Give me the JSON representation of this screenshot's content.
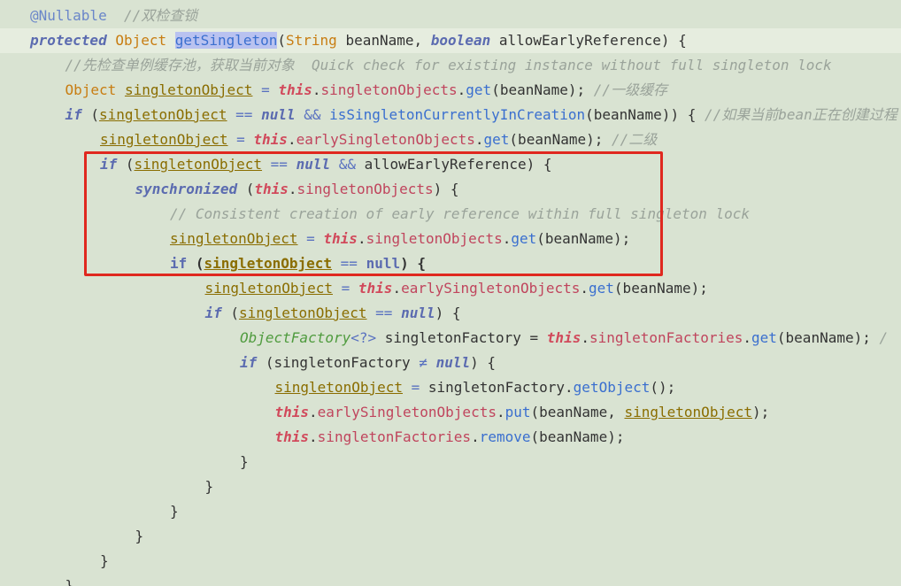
{
  "editor": {
    "lines": [
      {
        "indent": 0,
        "segments": [
          {
            "t": "@Nullable",
            "c": "ann"
          },
          {
            "t": "  ",
            "c": "text"
          },
          {
            "t": "//双检查锁",
            "c": "comment"
          }
        ]
      },
      {
        "indent": 0,
        "current": true,
        "segments": [
          {
            "t": "protected",
            "c": "kw"
          },
          {
            "t": " ",
            "c": "text"
          },
          {
            "t": "Object",
            "c": "type"
          },
          {
            "t": " ",
            "c": "text"
          },
          {
            "t": "getSingleton",
            "c": "sel"
          },
          {
            "t": "(",
            "c": "text"
          },
          {
            "t": "String",
            "c": "type"
          },
          {
            "t": " beanName, ",
            "c": "text"
          },
          {
            "t": "boolean",
            "c": "kw"
          },
          {
            "t": " allowEarlyReference) {",
            "c": "text"
          }
        ]
      },
      {
        "indent": 1,
        "segments": [
          {
            "t": "//先检查单例缓存池，获取当前对象  Quick check for existing instance without full singleton lock",
            "c": "comment"
          }
        ]
      },
      {
        "indent": 1,
        "segments": [
          {
            "t": "Object",
            "c": "type"
          },
          {
            "t": " ",
            "c": "text"
          },
          {
            "t": "singletonObject",
            "c": "var"
          },
          {
            "t": " = ",
            "c": "op"
          },
          {
            "t": "this",
            "c": "this"
          },
          {
            "t": ".",
            "c": "text"
          },
          {
            "t": "singletonObjects",
            "c": "field"
          },
          {
            "t": ".",
            "c": "text"
          },
          {
            "t": "get",
            "c": "method"
          },
          {
            "t": "(beanName); ",
            "c": "text"
          },
          {
            "t": "//一级缓存",
            "c": "comment"
          }
        ]
      },
      {
        "indent": 1,
        "segments": [
          {
            "t": "if",
            "c": "kw"
          },
          {
            "t": " (",
            "c": "text"
          },
          {
            "t": "singletonObject",
            "c": "var"
          },
          {
            "t": " == ",
            "c": "op"
          },
          {
            "t": "null",
            "c": "kw"
          },
          {
            "t": " && ",
            "c": "op"
          },
          {
            "t": "isSingletonCurrentlyInCreation",
            "c": "method"
          },
          {
            "t": "(beanName)) { ",
            "c": "text"
          },
          {
            "t": "//如果当前bean正在创建过程",
            "c": "comment"
          }
        ]
      },
      {
        "indent": 2,
        "segments": [
          {
            "t": "singletonObject",
            "c": "var"
          },
          {
            "t": " = ",
            "c": "op"
          },
          {
            "t": "this",
            "c": "this"
          },
          {
            "t": ".",
            "c": "text"
          },
          {
            "t": "earlySingletonObjects",
            "c": "field"
          },
          {
            "t": ".",
            "c": "text"
          },
          {
            "t": "get",
            "c": "method"
          },
          {
            "t": "(beanName); ",
            "c": "text"
          },
          {
            "t": "//二级",
            "c": "comment"
          }
        ]
      },
      {
        "indent": 2,
        "segments": [
          {
            "t": "if",
            "c": "kw"
          },
          {
            "t": " (",
            "c": "text"
          },
          {
            "t": "singletonObject",
            "c": "var"
          },
          {
            "t": " == ",
            "c": "op"
          },
          {
            "t": "null",
            "c": "kw"
          },
          {
            "t": " && ",
            "c": "op"
          },
          {
            "t": "allowEarlyReference) {",
            "c": "text"
          }
        ]
      },
      {
        "indent": 3,
        "segments": [
          {
            "t": "synchronized",
            "c": "kw"
          },
          {
            "t": " (",
            "c": "text"
          },
          {
            "t": "this",
            "c": "this"
          },
          {
            "t": ".",
            "c": "text"
          },
          {
            "t": "singletonObjects",
            "c": "field"
          },
          {
            "t": ") {",
            "c": "text"
          }
        ]
      },
      {
        "indent": 4,
        "segments": [
          {
            "t": "// Consistent creation of early reference within full singleton lock",
            "c": "comment"
          }
        ]
      },
      {
        "indent": 4,
        "segments": [
          {
            "t": "singletonObject",
            "c": "var"
          },
          {
            "t": " = ",
            "c": "op"
          },
          {
            "t": "this",
            "c": "this"
          },
          {
            "t": ".",
            "c": "text"
          },
          {
            "t": "singletonObjects",
            "c": "field"
          },
          {
            "t": ".",
            "c": "text"
          },
          {
            "t": "get",
            "c": "method"
          },
          {
            "t": "(beanName);",
            "c": "text"
          }
        ]
      },
      {
        "indent": 4,
        "segments": [
          {
            "t": "if",
            "c": "kwb"
          },
          {
            "t": " (",
            "c": "textb"
          },
          {
            "t": "singletonObject",
            "c": "varb"
          },
          {
            "t": " == ",
            "c": "op"
          },
          {
            "t": "null",
            "c": "kwb"
          },
          {
            "t": ") {",
            "c": "textb"
          }
        ]
      },
      {
        "indent": 5,
        "segments": [
          {
            "t": "singletonObject",
            "c": "var"
          },
          {
            "t": " = ",
            "c": "op"
          },
          {
            "t": "this",
            "c": "this"
          },
          {
            "t": ".",
            "c": "text"
          },
          {
            "t": "earlySingletonObjects",
            "c": "field"
          },
          {
            "t": ".",
            "c": "text"
          },
          {
            "t": "get",
            "c": "method"
          },
          {
            "t": "(beanName);",
            "c": "text"
          }
        ]
      },
      {
        "indent": 5,
        "segments": [
          {
            "t": "if",
            "c": "kw"
          },
          {
            "t": " (",
            "c": "text"
          },
          {
            "t": "singletonObject",
            "c": "var"
          },
          {
            "t": " == ",
            "c": "op"
          },
          {
            "t": "null",
            "c": "kw"
          },
          {
            "t": ") {",
            "c": "text"
          }
        ]
      },
      {
        "indent": 6,
        "segments": [
          {
            "t": "ObjectFactory",
            "c": "iface"
          },
          {
            "t": "<?>",
            "c": "op"
          },
          {
            "t": " singletonFactory = ",
            "c": "text"
          },
          {
            "t": "this",
            "c": "this"
          },
          {
            "t": ".",
            "c": "text"
          },
          {
            "t": "singletonFactories",
            "c": "field"
          },
          {
            "t": ".",
            "c": "text"
          },
          {
            "t": "get",
            "c": "method"
          },
          {
            "t": "(beanName); ",
            "c": "text"
          },
          {
            "t": "/",
            "c": "comment"
          }
        ]
      },
      {
        "indent": 6,
        "segments": [
          {
            "t": "if",
            "c": "kw"
          },
          {
            "t": " (singletonFactory ",
            "c": "text"
          },
          {
            "t": "≠",
            "c": "op"
          },
          {
            "t": " ",
            "c": "text"
          },
          {
            "t": "null",
            "c": "kw"
          },
          {
            "t": ") {",
            "c": "text"
          }
        ]
      },
      {
        "indent": 7,
        "segments": [
          {
            "t": "singletonObject",
            "c": "var"
          },
          {
            "t": " = ",
            "c": "op"
          },
          {
            "t": "singletonFactory.",
            "c": "text"
          },
          {
            "t": "getObject",
            "c": "method"
          },
          {
            "t": "();",
            "c": "text"
          }
        ]
      },
      {
        "indent": 7,
        "segments": [
          {
            "t": "this",
            "c": "this"
          },
          {
            "t": ".",
            "c": "text"
          },
          {
            "t": "earlySingletonObjects",
            "c": "field"
          },
          {
            "t": ".",
            "c": "text"
          },
          {
            "t": "put",
            "c": "method"
          },
          {
            "t": "(beanName, ",
            "c": "text"
          },
          {
            "t": "singletonObject",
            "c": "var"
          },
          {
            "t": ");",
            "c": "text"
          }
        ]
      },
      {
        "indent": 7,
        "segments": [
          {
            "t": "this",
            "c": "this"
          },
          {
            "t": ".",
            "c": "text"
          },
          {
            "t": "singletonFactories",
            "c": "field"
          },
          {
            "t": ".",
            "c": "text"
          },
          {
            "t": "remove",
            "c": "method"
          },
          {
            "t": "(beanName);",
            "c": "text"
          }
        ]
      },
      {
        "indent": 6,
        "segments": [
          {
            "t": "}",
            "c": "text"
          }
        ]
      },
      {
        "indent": 5,
        "segments": [
          {
            "t": "}",
            "c": "text"
          }
        ]
      },
      {
        "indent": 4,
        "segments": [
          {
            "t": "}",
            "c": "text"
          }
        ]
      },
      {
        "indent": 3,
        "segments": [
          {
            "t": "}",
            "c": "text"
          }
        ]
      },
      {
        "indent": 2,
        "segments": [
          {
            "t": "}",
            "c": "text"
          }
        ]
      },
      {
        "indent": 1,
        "segments": [
          {
            "t": "}",
            "c": "text"
          }
        ]
      }
    ]
  },
  "colors": {
    "background": "#d9e3d2",
    "highlight_box": "#e0281f",
    "selection": "#b9c2f0"
  }
}
